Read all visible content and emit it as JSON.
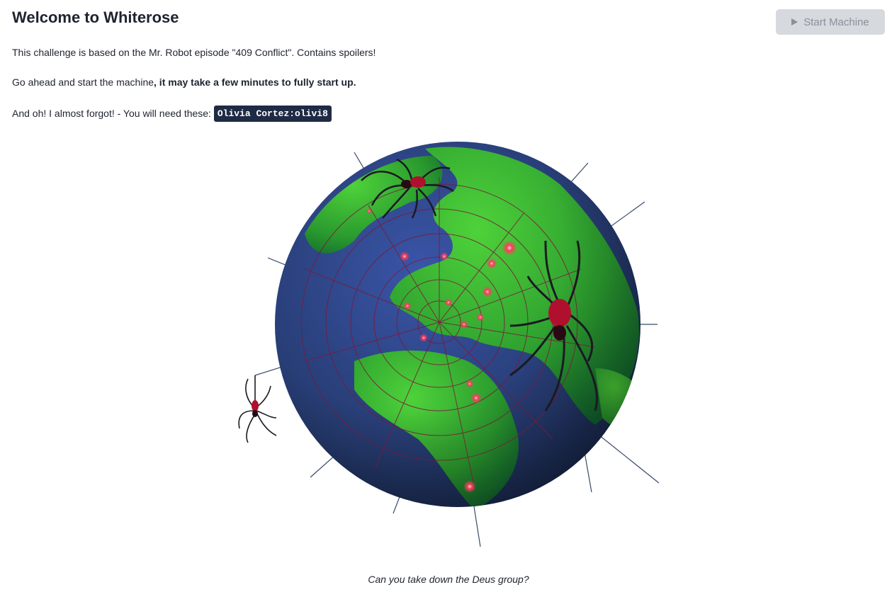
{
  "header": {
    "title": "Welcome to Whiterose",
    "start_button_label": "Start Machine",
    "start_button_icon": "play-icon"
  },
  "content": {
    "intro": "This challenge is based on the Mr. Robot episode \"409 Conflict\". Contains spoilers!",
    "start_text": "Go ahead and start the machine",
    "start_note": ", it may take a few minutes to fully start up.",
    "credentials_intro": "And oh! I almost forgot! - You will need these: ",
    "credentials": "Olivia Cortez:olivi8",
    "caption": "Can you take down the Deus group?"
  },
  "colors": {
    "ocean": "#253a6e",
    "land": "#3db52f",
    "web": "#7a1a3a",
    "glow": "#ff3b5c",
    "code_bg": "#1f2a44"
  }
}
